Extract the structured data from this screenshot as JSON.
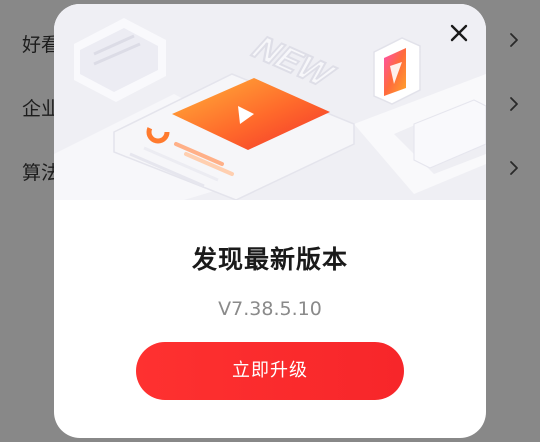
{
  "background_list": {
    "items": [
      {
        "label": "好看"
      },
      {
        "label": "企业"
      },
      {
        "label": "算法"
      }
    ]
  },
  "dialog": {
    "illustration": {
      "badge_text": "NEW",
      "icon": "play-icon"
    },
    "title": "发现最新版本",
    "version": "V7.38.5.10",
    "upgrade_label": "立即升级",
    "close_icon": "close-icon"
  },
  "colors": {
    "accent": "#fb2b2c",
    "overlay": "#888888",
    "title": "#1a1a1a",
    "version_text": "#8a8a8a"
  }
}
